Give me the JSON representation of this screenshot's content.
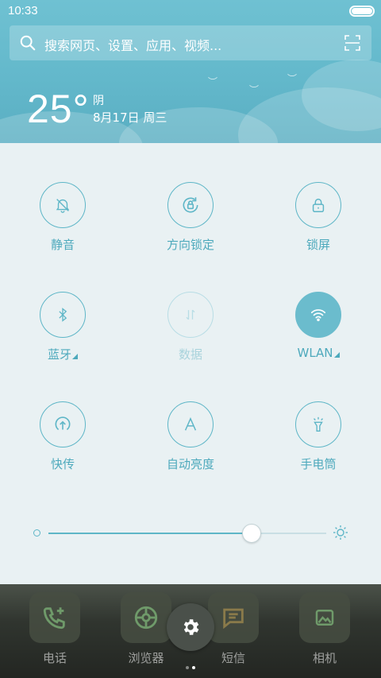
{
  "status_bar": {
    "time": "10:33",
    "battery_level": 1.0
  },
  "search": {
    "placeholder": "搜索网页、设置、应用、视频..."
  },
  "weather": {
    "temperature": "25°",
    "condition": "阴",
    "date": "8月17日 周三"
  },
  "toggles": [
    {
      "label": "静音",
      "icon": "bell-mute-icon",
      "state": "off_outline"
    },
    {
      "label": "方向锁定",
      "icon": "rotation-lock-icon",
      "state": "outline"
    },
    {
      "label": "锁屏",
      "icon": "lock-icon",
      "state": "outline"
    },
    {
      "label": "蓝牙",
      "icon": "bluetooth-icon",
      "state": "outline",
      "has_more": true
    },
    {
      "label": "数据",
      "icon": "mobile-data-icon",
      "state": "disabled"
    },
    {
      "label": "WLAN",
      "icon": "wifi-icon",
      "state": "on",
      "has_more": true
    },
    {
      "label": "快传",
      "icon": "quick-share-icon",
      "state": "outline"
    },
    {
      "label": "自动亮度",
      "icon": "auto-brightness-icon",
      "state": "outline"
    },
    {
      "label": "手电筒",
      "icon": "flashlight-icon",
      "state": "outline"
    }
  ],
  "brightness": {
    "level": 0.73
  },
  "dock": {
    "apps": [
      {
        "label": "电话",
        "icon": "phone-icon"
      },
      {
        "label": "浏览器",
        "icon": "browser-icon"
      },
      {
        "label": "短信",
        "icon": "message-icon"
      },
      {
        "label": "相机",
        "icon": "camera-icon"
      }
    ],
    "settings_icon": "gear-icon",
    "page_indicator": {
      "pages": 2,
      "active": 1
    }
  },
  "colors": {
    "accent": "#5eb6c7",
    "header_bg": "#63b8cb",
    "panel_bg": "#e9f1f3",
    "toggle_on": "#6bbccd"
  }
}
